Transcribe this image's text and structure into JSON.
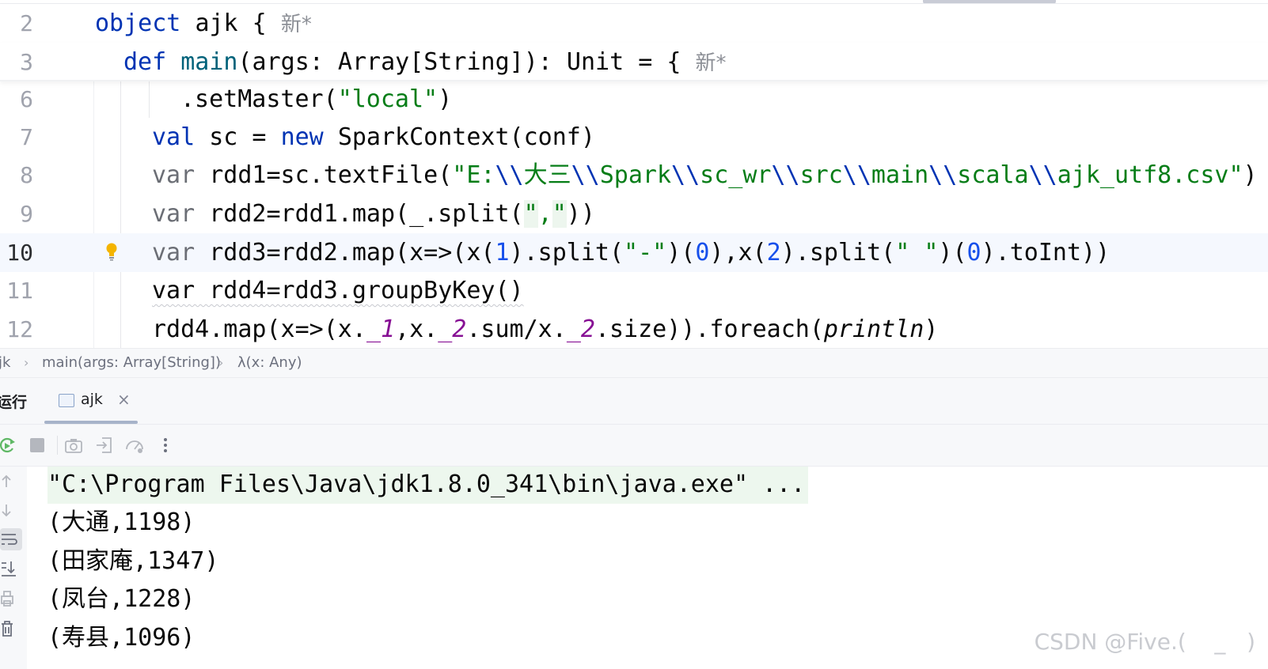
{
  "editor": {
    "sticky_lines": [
      {
        "num": "2",
        "tokens": [
          {
            "t": "object ",
            "c": "kw"
          },
          {
            "t": "ajk { ",
            "c": ""
          },
          {
            "t": "新",
            "c": "hint"
          },
          {
            "t": "*",
            "c": "hint"
          }
        ]
      },
      {
        "num": "3",
        "tokens": [
          {
            "t": "def ",
            "c": "kw"
          },
          {
            "t": "main",
            "c": "fn"
          },
          {
            "t": "(args: Array[String]): Unit = { ",
            "c": ""
          },
          {
            "t": "新",
            "c": "hint"
          },
          {
            "t": "*",
            "c": "hint"
          }
        ]
      }
    ],
    "lines": [
      {
        "num": "6",
        "tokens": [
          {
            "t": ".setMaster(",
            "c": ""
          },
          {
            "t": "\"local\"",
            "c": "str"
          },
          {
            "t": ")",
            "c": ""
          }
        ]
      },
      {
        "num": "7",
        "tokens": [
          {
            "t": "val ",
            "c": "kw"
          },
          {
            "t": "sc = ",
            "c": ""
          },
          {
            "t": "new ",
            "c": "kw"
          },
          {
            "t": "SparkContext(conf)",
            "c": ""
          }
        ]
      },
      {
        "num": "8",
        "tokens": [
          {
            "t": "var ",
            "c": "gray"
          },
          {
            "t": "rdd1=sc.textFile(",
            "c": ""
          },
          {
            "t": "\"E:",
            "c": "str"
          },
          {
            "t": "\\\\",
            "c": "kw"
          },
          {
            "t": "大三",
            "c": "str"
          },
          {
            "t": "\\\\",
            "c": "kw"
          },
          {
            "t": "Spark",
            "c": "str"
          },
          {
            "t": "\\\\",
            "c": "kw"
          },
          {
            "t": "sc_wr",
            "c": "str"
          },
          {
            "t": "\\\\",
            "c": "kw"
          },
          {
            "t": "src",
            "c": "str"
          },
          {
            "t": "\\\\",
            "c": "kw"
          },
          {
            "t": "main",
            "c": "str"
          },
          {
            "t": "\\\\",
            "c": "kw"
          },
          {
            "t": "scala",
            "c": "str"
          },
          {
            "t": "\\\\",
            "c": "kw"
          },
          {
            "t": "ajk_utf8.csv\"",
            "c": "str"
          },
          {
            "t": ")",
            "c": ""
          }
        ]
      },
      {
        "num": "9",
        "tokens": [
          {
            "t": "var ",
            "c": "gray"
          },
          {
            "t": "rdd2=rdd1.map(_.split(",
            "c": ""
          },
          {
            "t": "\"",
            "c": "str quote-hl"
          },
          {
            "t": ",",
            "c": "str"
          },
          {
            "t": "\"",
            "c": "str quote-hl"
          },
          {
            "t": "))",
            "c": ""
          }
        ]
      },
      {
        "num": "10",
        "current": true,
        "tokens": [
          {
            "t": "var ",
            "c": "gray"
          },
          {
            "t": "rdd3=rdd2.map(x=>(x(",
            "c": ""
          },
          {
            "t": "1",
            "c": "num"
          },
          {
            "t": ").split(",
            "c": ""
          },
          {
            "t": "\"-\"",
            "c": "str"
          },
          {
            "t": ")(",
            "c": ""
          },
          {
            "t": "0",
            "c": "num"
          },
          {
            "t": "),x(",
            "c": ""
          },
          {
            "t": "2",
            "c": "num"
          },
          {
            "t": ").split(",
            "c": ""
          },
          {
            "t": "\" \"",
            "c": "str"
          },
          {
            "t": ")(",
            "c": ""
          },
          {
            "t": "0",
            "c": "num"
          },
          {
            "t": ").toInt))",
            "c": ""
          }
        ]
      },
      {
        "num": "11",
        "tokens": [
          {
            "t": "var rdd4=rdd3.groupByKey()",
            "c": "squig"
          }
        ]
      },
      {
        "num": "12",
        "tokens": [
          {
            "t": "rdd4.map(x=>(x.",
            "c": ""
          },
          {
            "t": "_1",
            "c": "mem"
          },
          {
            "t": ",x.",
            "c": ""
          },
          {
            "t": "_2",
            "c": "mem"
          },
          {
            "t": ".sum/x.",
            "c": ""
          },
          {
            "t": "_2",
            "c": "mem"
          },
          {
            "t": ".size)).foreach(",
            "c": ""
          },
          {
            "t": "println",
            "c": "ital"
          },
          {
            "t": ")",
            "c": ""
          }
        ]
      }
    ]
  },
  "breadcrumb": [
    "jk",
    "main(args: Array[String])",
    "λ(x: Any)"
  ],
  "run_panel": {
    "title": "运行",
    "tab_label": "ajk",
    "tab_close": "×",
    "toolbar_icons": [
      "rerun-icon",
      "stop-icon",
      "camera-icon",
      "exit-icon",
      "profiler-icon",
      "more-icon"
    ],
    "side_icons": [
      "up-arrow-icon",
      "down-arrow-icon",
      "soft-wrap-icon",
      "scroll-to-end-icon",
      "print-icon",
      "trash-icon"
    ]
  },
  "console": {
    "command": "\"C:\\Program Files\\Java\\jdk1.8.0_341\\bin\\java.exe\" ...",
    "output": [
      "(大通,1198)",
      "(田家庵,1347)",
      "(凤台,1228)",
      "(寿县,1096)"
    ]
  },
  "watermark": "CSDN @Five.(    _   )",
  "colors": {
    "keyword": "#0033b3",
    "function": "#00627a",
    "string": "#067d17",
    "number": "#1750eb",
    "member": "#871094",
    "current_line": "#f5f8fe"
  }
}
